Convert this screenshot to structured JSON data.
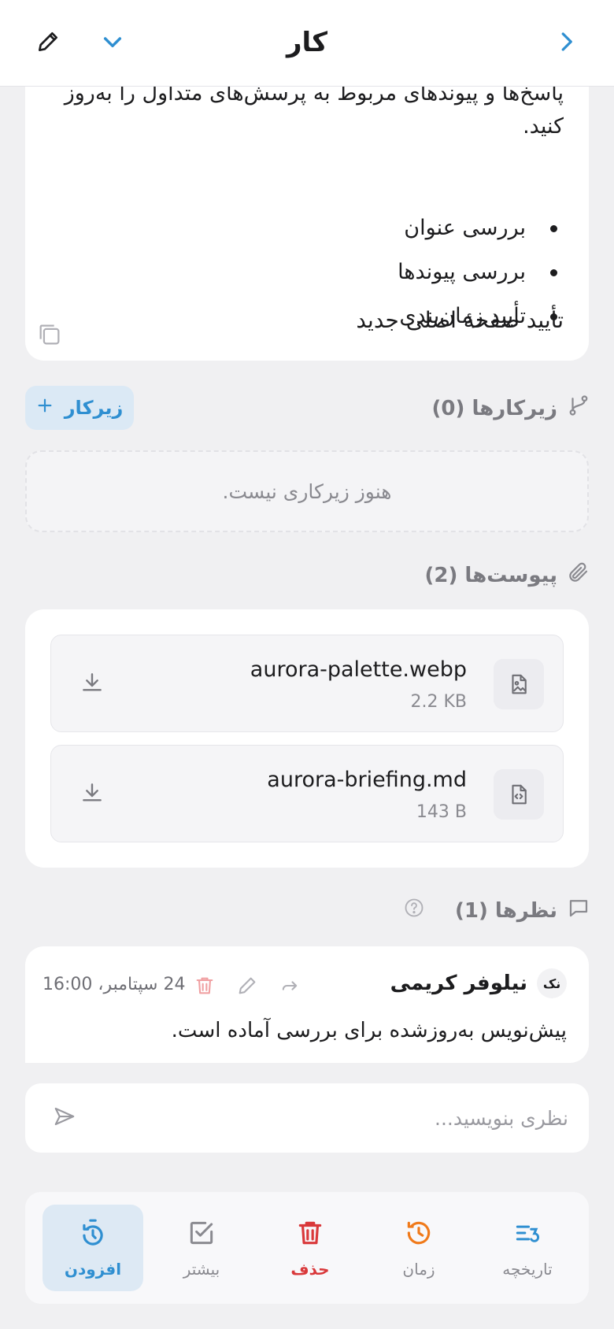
{
  "header": {
    "title": "کار"
  },
  "description": {
    "text": "پاسخ‌ها و پیوندهای مربوط به پرسش‌های متداول را به‌روز کنید.",
    "items": [
      "بررسی عنوان",
      "بررسی پیوندها",
      "تأیید زمان‌بندی"
    ],
    "footer": "تأیید صفحهٔ اصلی جدید"
  },
  "subtasks": {
    "title": "زیرکارها (0)",
    "add_label": "زیرکار",
    "empty": "هنوز زیرکاری نیست."
  },
  "attachments": {
    "title": "پیوست‌ها (2)",
    "files": [
      {
        "name": "aurora-palette.webp",
        "size": "2.2 KB",
        "icon": "image-file-icon"
      },
      {
        "name": "aurora-briefing.md",
        "size": "143 B",
        "icon": "code-file-icon"
      }
    ]
  },
  "comments": {
    "title": "نظرها (1)",
    "items": [
      {
        "avatar": "نک",
        "author": "نیلوفر کریمی",
        "time": "24 سپتامبر، 16:00",
        "body": "پیش‌نویس به‌روزشده برای بررسی آماده است."
      }
    ],
    "placeholder": "نظری بنویسید..."
  },
  "toolbar": {
    "items": [
      {
        "label": "تاریخچه",
        "icon": "history-list-icon"
      },
      {
        "label": "زمان",
        "icon": "clock-history-icon"
      },
      {
        "label": "حذف",
        "icon": "trash-icon"
      },
      {
        "label": "بیشتر",
        "icon": "checkbox-icon"
      },
      {
        "label": "افزودن",
        "icon": "timer-add-icon"
      }
    ]
  },
  "colors": {
    "accent": "#2f8fd1",
    "danger": "#d9383a",
    "orange": "#f07a1a"
  }
}
